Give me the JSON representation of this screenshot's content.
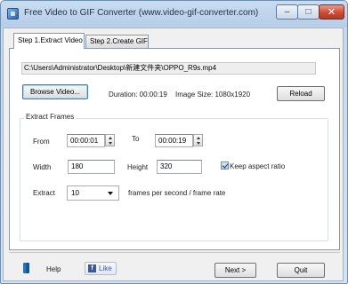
{
  "window": {
    "title": "Free Video to GIF Converter (www.video-gif-converter.com)",
    "controls": {
      "minimize": "–",
      "maximize": "□",
      "close": "✕"
    }
  },
  "tabs": [
    {
      "label": "Step 1.Extract Video",
      "active": true
    },
    {
      "label": "Step 2.Create GIF",
      "active": false
    }
  ],
  "extract": {
    "file_path": "C:\\Users\\Administrator\\Desktop\\新建文件夹\\OPPO_R9s.mp4",
    "browse_label": "Browse Video...",
    "duration_text": "Duration: 00:00:19",
    "image_size_text": "Image Size: 1080x1920",
    "reload_label": "Reload"
  },
  "frames": {
    "group_label": "Extract Frames",
    "from_label": "From",
    "from_value": "00:00:01",
    "to_label": "To",
    "to_value": "00:00:19",
    "width_label": "Width",
    "width_value": "180",
    "height_label": "Height",
    "height_value": "320",
    "keep_aspect_label": "Keep aspect ratio",
    "keep_aspect_checked": true,
    "extract_label": "Extract",
    "extract_value": "10",
    "fps_label": "frames per second / frame rate"
  },
  "footer": {
    "help_label": "Help",
    "like_label": "Like",
    "like_icon_glyph": "f",
    "next_label": "Next >",
    "quit_label": "Quit"
  },
  "colors": {
    "title_bar": "#c9dcf1",
    "close_button": "#c84d37",
    "facebook_blue": "#3b5998",
    "focus_border": "#3c7fb1"
  }
}
